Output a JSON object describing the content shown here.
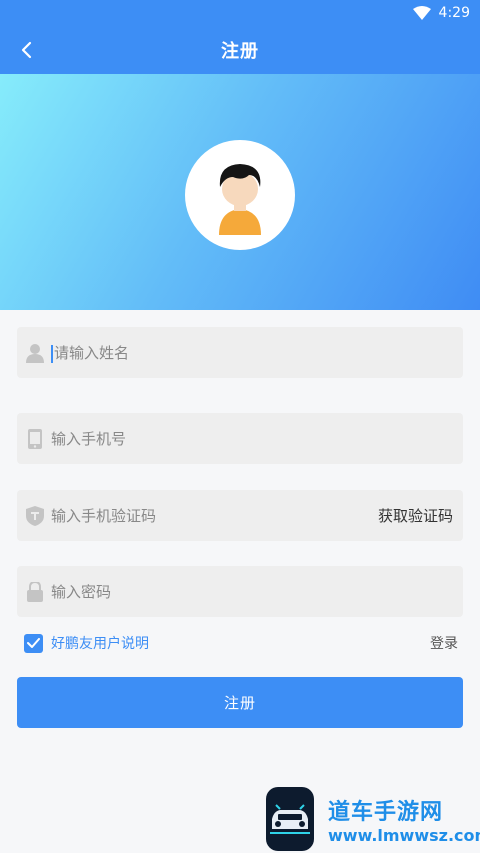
{
  "status_bar": {
    "time": "4:29"
  },
  "app_bar": {
    "title": "注册"
  },
  "form": {
    "name_placeholder": "请输入姓名",
    "phone_placeholder": "输入手机号",
    "code_placeholder": "输入手机验证码",
    "get_code_label": "获取验证码",
    "password_placeholder": "输入密码",
    "agreement_label": "好鹏友用户说明",
    "agreement_checked": true,
    "login_label": "登录",
    "register_label": "注册"
  },
  "watermark": {
    "title": "道车手游网",
    "url": "www.lmwwsz.com"
  },
  "colors": {
    "primary": "#3d8ef5",
    "field_bg": "#eeeeee",
    "page_bg": "#f6f7f9"
  }
}
